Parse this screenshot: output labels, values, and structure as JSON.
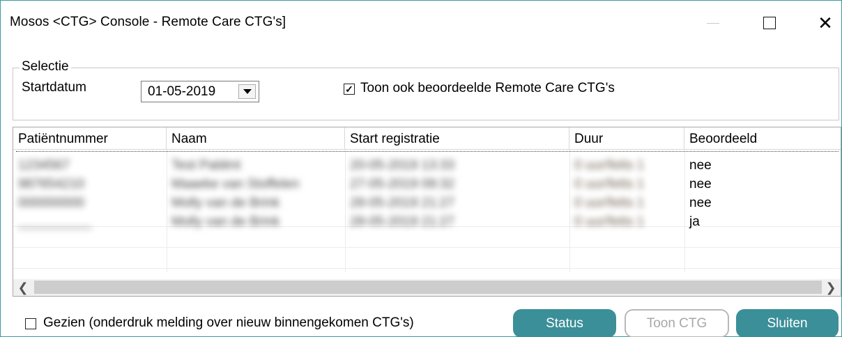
{
  "window": {
    "title": "Mosos <CTG> Console - Remote Care CTG's]",
    "close_glyph": "✕"
  },
  "selectie": {
    "legend": "Selectie",
    "startdatum_label": "Startdatum",
    "startdatum_value": "01-05-2019",
    "toon_checkbox_checked": true,
    "toon_checkbox_label": "Toon ook beoordeelde Remote Care CTG's"
  },
  "table": {
    "columns": [
      "Patiëntnummer",
      "Naam",
      "Start registratie",
      "Duur",
      "Beoordeeld"
    ],
    "rows": [
      {
        "patientnummer": "1234567",
        "naam": "Test Patiënt",
        "start": "20-05-2019 13:33",
        "duur": "0 uur/fetts 1",
        "beoordeeld": "nee"
      },
      {
        "patientnummer": "987654210",
        "naam": "Maaeke van Stoffelen",
        "start": "27-05-2019 09:32",
        "duur": "0 uur/fetts 1",
        "beoordeeld": "nee"
      },
      {
        "patientnummer": "000000000",
        "naam": "Molly van de Brink",
        "start": "28-05-2019 21:27",
        "duur": "0 uur/fetts 1",
        "beoordeeld": "nee"
      },
      {
        "patientnummer": "__________",
        "naam": "Molly van de Brink",
        "start": "28-05-2019 21:27",
        "duur": "0 uur/fetts 1",
        "beoordeeld": "ja"
      }
    ]
  },
  "bottom": {
    "gezien_checked": false,
    "gezien_label": "Gezien (onderdruk melding over nieuw binnengekomen CTG's)",
    "status_button": "Status",
    "toon_ctg_button": "Toon CTG",
    "sluiten_button": "Sluiten"
  },
  "colors": {
    "accent": "#3b8f98",
    "window_border": "#3a9a9e",
    "disabled_text": "#a8a8a8"
  },
  "icons": {
    "minimize": "minimize-icon",
    "maximize": "maximize-icon",
    "close": "close-icon",
    "dropdown": "chevron-down-icon",
    "scroll_left": "chevron-left-icon",
    "scroll_right": "chevron-right-icon",
    "check": "checkmark-icon"
  }
}
